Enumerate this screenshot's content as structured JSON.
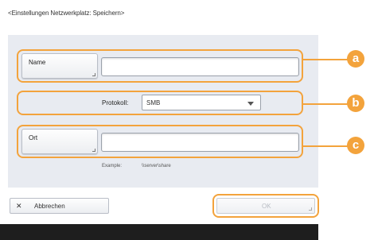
{
  "header": {
    "title": "<Einstellungen Netzwerkplatz: Speichern>"
  },
  "form": {
    "name_button_label": "Name",
    "name_value": "",
    "protocol_label": "Protokoll:",
    "protocol_value": "SMB",
    "location_button_label": "Ort",
    "location_value": "",
    "example_label": "Example:",
    "example_value": "\\\\server\\share"
  },
  "callouts": {
    "a": "a",
    "b": "b",
    "c": "c"
  },
  "footer": {
    "cancel_label": "Abbrechen",
    "ok_label": "OK"
  },
  "colors": {
    "highlight": "#f3a33c",
    "panel": "#e8ebf1",
    "bottom_bar": "#1e1e1e"
  }
}
